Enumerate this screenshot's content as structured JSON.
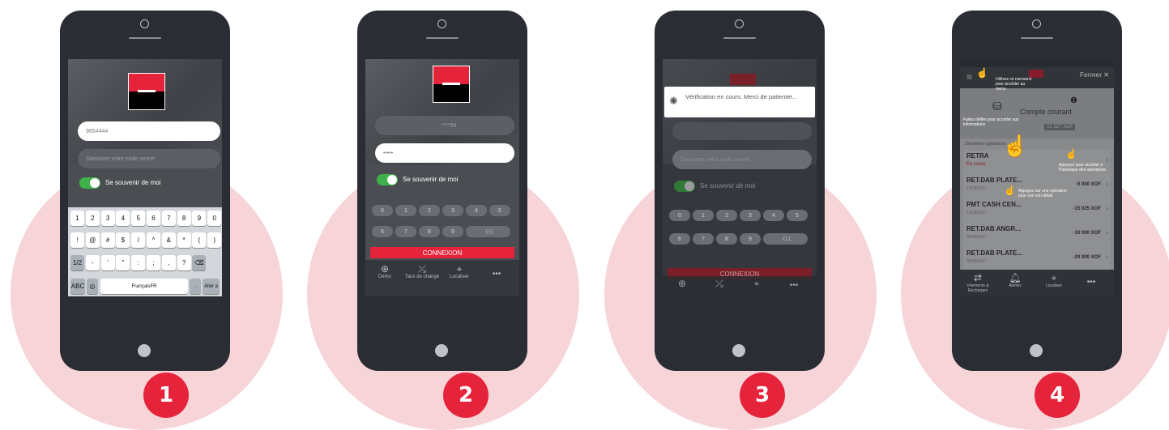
{
  "steps": [
    "1",
    "2",
    "3",
    "4"
  ],
  "step1": {
    "login_value": "9654444",
    "password_placeholder": "Saisissez votre code secret",
    "remember_label": "Se souvenir de moi",
    "kbd_row1": [
      "1",
      "2",
      "3",
      "4",
      "5",
      "6",
      "7",
      "8",
      "9",
      "0"
    ],
    "kbd_row2": [
      "!",
      "@",
      "#",
      "$",
      "/",
      "^",
      "&",
      "*",
      "(",
      ")"
    ],
    "kbd_row3": [
      "1/2",
      "-",
      "'",
      "\"",
      ":",
      ";",
      ",",
      "?",
      "⌫"
    ],
    "kbd_abc": "ABC",
    "kbd_space": "FrançaisFR",
    "kbd_go": "Aller à"
  },
  "step2": {
    "login_value": "****99",
    "password_value": "•••••",
    "remember_label": "Se souvenir de moi",
    "pin_row1": [
      "0",
      "1",
      "2",
      "3",
      "4",
      "5"
    ],
    "pin_row2": [
      "6",
      "7",
      "8",
      "9",
      "〈〈〈"
    ],
    "connexion": "CONNEXION",
    "tabs": [
      "Démo",
      "Taux de change",
      "Localiser",
      "•••"
    ]
  },
  "step3": {
    "toast": "Vérification en cours. Merci de patienter...",
    "password_placeholder": "Saisissez votre code secret",
    "remember_label": "Se souvenir de moi",
    "pin_row1": [
      "0",
      "1",
      "2",
      "3",
      "4",
      "5"
    ],
    "pin_row2": [
      "6",
      "7",
      "8",
      "9",
      "〈〈〈"
    ],
    "connexion": "CONNEXION",
    "tabs": [
      "Démo",
      "Taux de change",
      "Localiser",
      "•••"
    ]
  },
  "step4": {
    "close": "Fermer",
    "account_title": "Compte courant",
    "account_balance": "22 227 XOF",
    "hint_menu": "Utilisez ce raccourci pour accéder au menu",
    "hint_swipe": "Faites défiler pour accéder aux informations",
    "hint_ops": "Appuyez pour accéder à l'historique des opérations",
    "hint_detail": "Appuyez sur une opération pour voir son détail",
    "section": "Dernières opérations",
    "rows": [
      {
        "name": "RETRA",
        "sub": "En cours",
        "amount": ""
      },
      {
        "name": "RET.DAB PLATE...",
        "sub": "10/08/2017",
        "amount": "-5 000 XOF"
      },
      {
        "name": "PMT CASH CEN...",
        "sub": "10/08/2017",
        "amount": "-15 025 XOF"
      },
      {
        "name": "RET.DAB ANGR...",
        "sub": "09/08/2017",
        "amount": "-10 000 XOF"
      },
      {
        "name": "RET.DAB PLATE...",
        "sub": "09/08/2017",
        "amount": "-20 000 XOF"
      }
    ],
    "tabs": [
      "Virements & Recharges",
      "Alertes",
      "Localiser",
      "•••"
    ]
  },
  "colors": {
    "accent": "#e5243b",
    "circle": "#f6d4d8",
    "phone": "#2a2d33",
    "toggle": "#3db24a"
  }
}
